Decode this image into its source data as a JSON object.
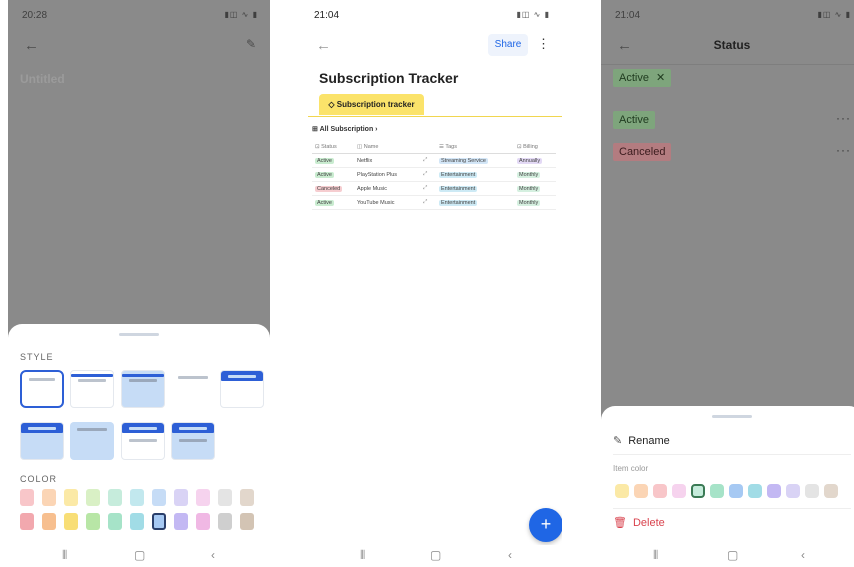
{
  "screen1": {
    "time": "20:28",
    "page_placeholder": "Untitled",
    "style_label": "STYLE",
    "color_label": "COLOR",
    "swatch_colors_row1": [
      "#f8c6c9",
      "#fbd5b5",
      "#fbe9a6",
      "#d9f0c5",
      "#c6ecdc",
      "#c2e8ee",
      "#c6dcf6",
      "#d9d3f5",
      "#f6d3ee",
      "#e4e4e4",
      "#e2d7cc"
    ],
    "swatch_colors_row2": [
      "#f2a8ae",
      "#f7bf8f",
      "#f8de76",
      "#b8e6a6",
      "#a6e3c8",
      "#a1dce6",
      "#a6c9f3",
      "#c3b8f3",
      "#f0b8e4",
      "#cfcfcf",
      "#d3c4b4"
    ]
  },
  "screen2": {
    "time": "21:04",
    "share_label": "Share",
    "title": "Subscription Tracker",
    "tab_label": "Subscription tracker",
    "view_label": "All Subscription",
    "columns": [
      "Status",
      "Name",
      "",
      "Tags",
      "Billing"
    ],
    "rows": [
      {
        "status": "Active",
        "status_color": "#c9ecd0",
        "name": "Netflix",
        "tag": "Streaming Service",
        "tag_color": "#d3e6f7",
        "billing": "Annually",
        "billing_color": "#e3d9f5"
      },
      {
        "status": "Active",
        "status_color": "#c9ecd0",
        "name": "PlayStation Plus",
        "tag": "Entertainment",
        "tag_color": "#cdeaf5",
        "billing": "Monthly",
        "billing_color": "#d5f0e0"
      },
      {
        "status": "Canceled",
        "status_color": "#f6cdd0",
        "name": "Apple Music",
        "tag": "Entertainment",
        "tag_color": "#cdeaf5",
        "billing": "Monthly",
        "billing_color": "#d5f0e0"
      },
      {
        "status": "Active",
        "status_color": "#c9ecd0",
        "name": "YouTube Music",
        "tag": "Entertainment",
        "tag_color": "#cdeaf5",
        "billing": "Monthly",
        "billing_color": "#d5f0e0"
      }
    ],
    "accent": "#1f66e5",
    "tab_color": "#fbe36a"
  },
  "screen3": {
    "time": "21:04",
    "title": "Status",
    "selected_chip": "Active",
    "options": [
      "Active",
      "Canceled"
    ],
    "rename_label": "Rename",
    "item_color_label": "Item color",
    "delete_label": "Delete",
    "item_colors": [
      "#fbe9a6",
      "#fbd5b5",
      "#f8c6c9",
      "#f6d3ee",
      "#c6ecdc",
      "#a6e3c8",
      "#a6c9f3",
      "#a1dce6",
      "#c3b8f3",
      "#d9d3f5",
      "#e4e4e4",
      "#e2d7cc"
    ]
  }
}
